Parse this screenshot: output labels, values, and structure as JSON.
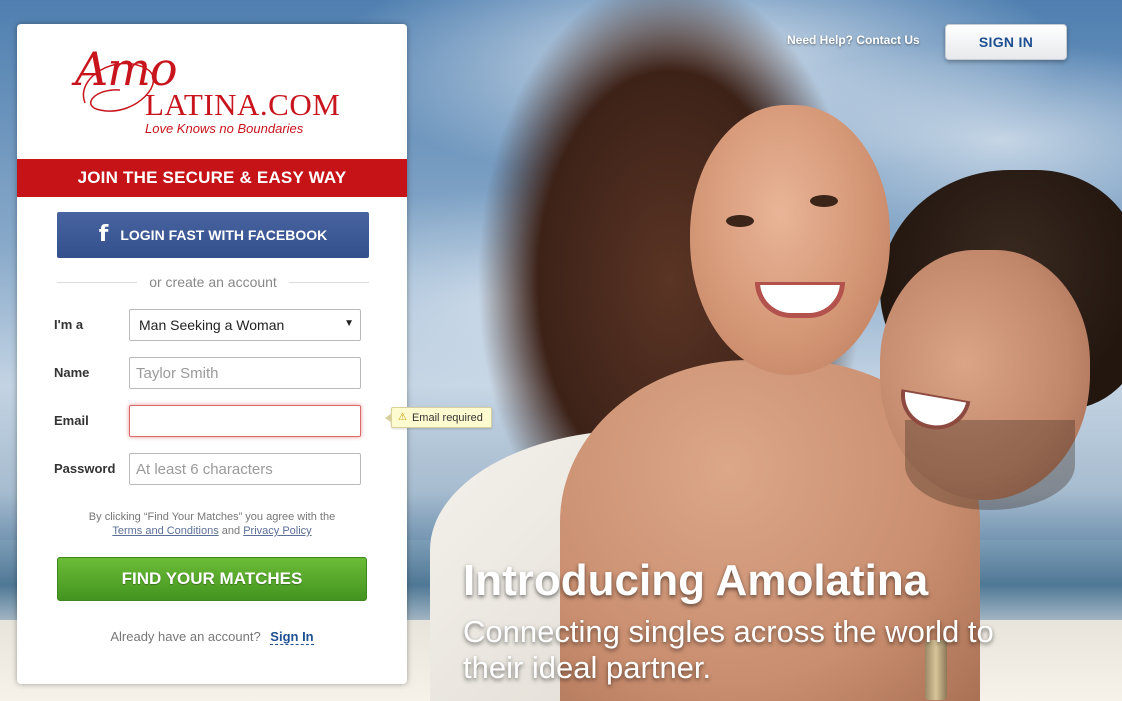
{
  "brand": {
    "logo_amo": "Amo",
    "logo_latina": "LATINA.COM",
    "tagline": "Love Knows no Boundaries",
    "accent_color": "#c61317"
  },
  "header": {
    "help_text": "Need Help?",
    "contact_link": "Contact Us",
    "signin_label": "SIGN IN"
  },
  "signup": {
    "banner": "JOIN THE SECURE & EASY WAY",
    "facebook_label": "LOGIN FAST WITH FACEBOOK",
    "facebook_icon": "facebook-f-icon",
    "divider_text": "or create an account",
    "fields": {
      "iam_label": "I'm a",
      "iam_value": "Man Seeking a Woman",
      "name_label": "Name",
      "name_placeholder": "Taylor Smith",
      "email_label": "Email",
      "email_value": "",
      "email_error": "Email required",
      "password_label": "Password",
      "password_placeholder": "At least 6 characters"
    },
    "terms_prefix": "By clicking “Find Your Matches” you agree with the",
    "terms_link": "Terms and Conditions",
    "terms_and": "and",
    "privacy_link": "Privacy Policy",
    "submit_label": "FIND YOUR MATCHES",
    "already_text": "Already have an account?",
    "signin_link": "Sign In"
  },
  "hero": {
    "headline": "Introducing Amolatina",
    "subline": "Connecting singles across the world to their ideal partner."
  }
}
